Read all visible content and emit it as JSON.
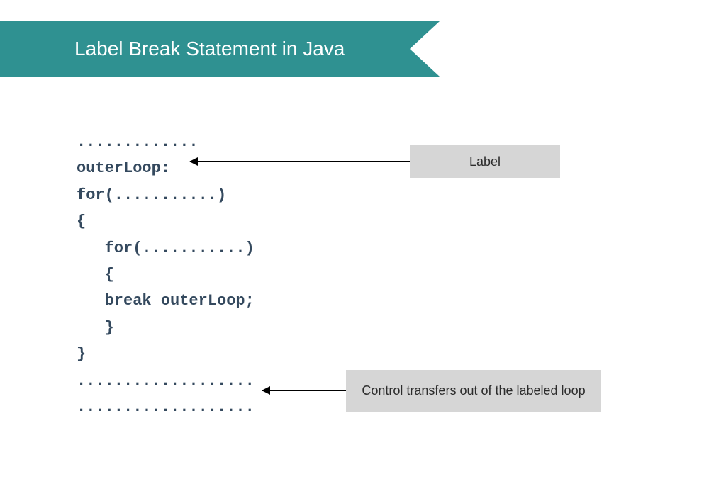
{
  "banner": {
    "title": "Label Break Statement in Java"
  },
  "code": {
    "line1": ".............",
    "line2": "outerLoop:",
    "line3": "for(...........)",
    "line4": "{",
    "line5": "   for(...........)",
    "line6": "   {",
    "line7": "   break outerLoop;",
    "line8": "   }",
    "line9": "}",
    "line10": "...................",
    "line11": "..................."
  },
  "annotations": {
    "label": "Label",
    "control": "Control transfers out of the labeled loop"
  }
}
